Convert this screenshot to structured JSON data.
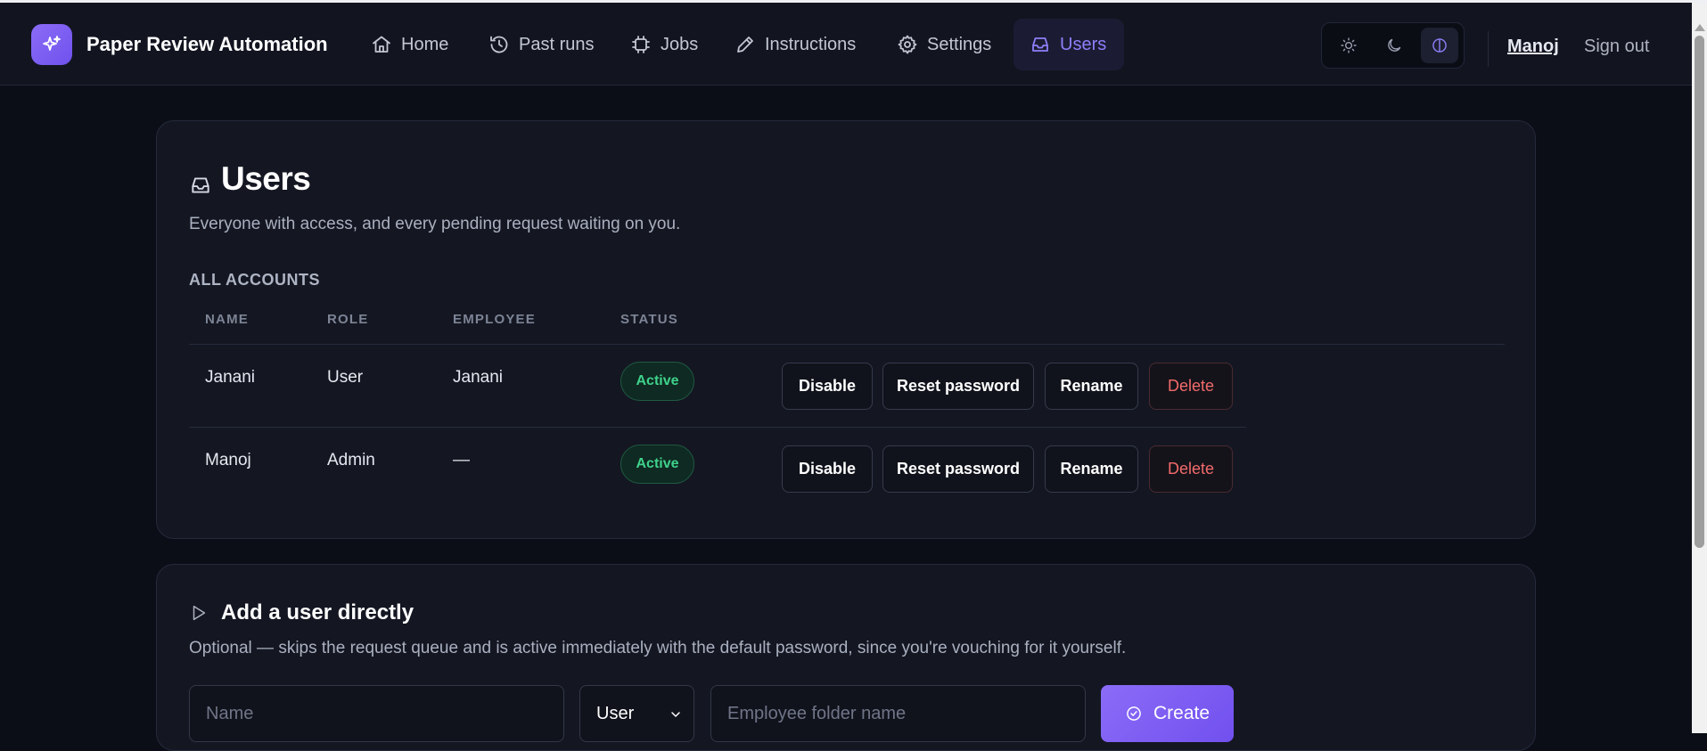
{
  "app": {
    "name": "Paper Review Automation",
    "logo_icon": "sparkles-icon"
  },
  "nav": {
    "items": [
      {
        "label": "Home",
        "icon": "home-icon",
        "active": false
      },
      {
        "label": "Past runs",
        "icon": "history-icon",
        "active": false
      },
      {
        "label": "Jobs",
        "icon": "cpu-icon",
        "active": false
      },
      {
        "label": "Instructions",
        "icon": "pencil-icon",
        "active": false
      },
      {
        "label": "Settings",
        "icon": "gear-icon",
        "active": false
      },
      {
        "label": "Users",
        "icon": "inbox-icon",
        "active": true
      }
    ],
    "theme_options": [
      "light",
      "dark",
      "contrast"
    ],
    "theme_selected": "contrast",
    "user_name": "Manoj",
    "sign_out_label": "Sign out"
  },
  "users_page": {
    "title": "Users",
    "description": "Everyone with access, and every pending request waiting on you.",
    "section_label": "ALL ACCOUNTS",
    "columns": [
      "NAME",
      "ROLE",
      "EMPLOYEE",
      "STATUS"
    ],
    "rows": [
      {
        "name": "Janani",
        "role": "User",
        "employee": "Janani",
        "status": "Active"
      },
      {
        "name": "Manoj",
        "role": "Admin",
        "employee": "—",
        "status": "Active"
      }
    ],
    "actions": {
      "disable": "Disable",
      "reset_password": "Reset password",
      "rename": "Rename",
      "delete": "Delete"
    }
  },
  "add_user": {
    "title": "Add a user directly",
    "description": "Optional — skips the request queue and is active immediately with the default password, since you're vouching for it yourself.",
    "name_placeholder": "Name",
    "role_selected": "User",
    "employee_placeholder": "Employee folder name",
    "create_label": "Create"
  },
  "colors": {
    "accent": "#8b6cf7",
    "active_badge": "#3fd28c",
    "danger": "#f26b6b",
    "background": "#0c0e17"
  }
}
